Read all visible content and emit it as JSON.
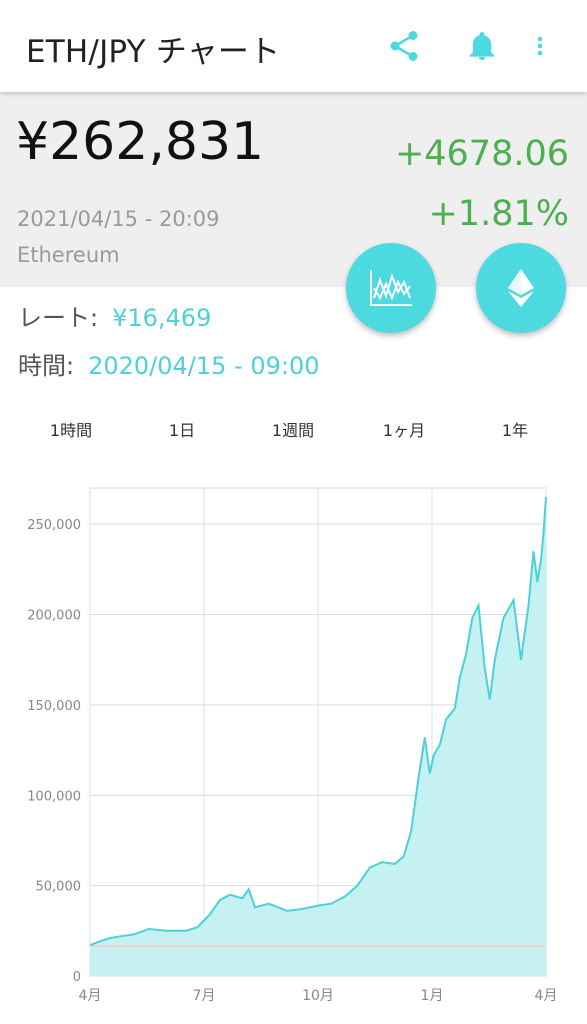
{
  "header": {
    "title": "ETH/JPY チャート"
  },
  "summary": {
    "price": "¥262,831",
    "change": "+4678.06",
    "change_pct": "+1.81%",
    "datetime": "2021/04/15 - 20:09",
    "coin": "Ethereum"
  },
  "info": {
    "rate_label": "レート:",
    "rate_value": "¥16,469",
    "time_label": "時間:",
    "time_value": "2020/04/15 - 09:00"
  },
  "tabs": [
    {
      "label": "1時間",
      "active": false
    },
    {
      "label": "1日",
      "active": false
    },
    {
      "label": "1週間",
      "active": false
    },
    {
      "label": "1ヶ月",
      "active": false
    },
    {
      "label": "1年",
      "active": true
    }
  ],
  "icons": {
    "share": "share-icon",
    "bell": "bell-icon",
    "more": "more-vert-icon",
    "chart_fab": "line-chart-icon",
    "coin_fab": "ethereum-icon"
  },
  "colors": {
    "accent": "#4dd9e0",
    "positive": "#4caf50",
    "line": "#4dd0d8",
    "fill": "#c6f1f2"
  },
  "chart_data": {
    "type": "area",
    "xlabel": "",
    "ylabel": "",
    "ylim": [
      0,
      270000
    ],
    "y_ticks": [
      0,
      50000,
      100000,
      150000,
      200000,
      250000
    ],
    "y_tick_labels": [
      "0",
      "50,000",
      "100,000",
      "150,000",
      "200,000",
      "250,000"
    ],
    "x_tick_labels": [
      "4月",
      "7月",
      "10月",
      "1月",
      "4月"
    ],
    "x_range": [
      "2020-04-15",
      "2021-04-15"
    ],
    "reference_line": 16469,
    "series": [
      {
        "x": [
          "2020-04-15",
          "2020-04-22",
          "2020-05-01",
          "2020-05-10",
          "2020-05-20",
          "2020-06-01",
          "2020-06-15",
          "2020-07-01",
          "2020-07-10",
          "2020-07-20",
          "2020-07-28",
          "2020-08-05",
          "2020-08-15",
          "2020-08-20",
          "2020-08-25",
          "2020-09-05",
          "2020-09-20",
          "2020-10-01",
          "2020-10-15",
          "2020-10-25",
          "2020-11-05",
          "2020-11-15",
          "2020-11-25",
          "2020-12-05",
          "2020-12-15",
          "2020-12-22",
          "2020-12-28",
          "2021-01-03",
          "2021-01-08",
          "2021-01-12",
          "2021-01-15",
          "2021-01-20",
          "2021-01-25",
          "2021-02-01",
          "2021-02-05",
          "2021-02-10",
          "2021-02-15",
          "2021-02-20",
          "2021-02-25",
          "2021-03-01",
          "2021-03-05",
          "2021-03-12",
          "2021-03-20",
          "2021-03-26",
          "2021-04-01",
          "2021-04-05",
          "2021-04-08",
          "2021-04-11",
          "2021-04-13",
          "2021-04-15"
        ],
        "values": [
          17000,
          19000,
          21000,
          22000,
          23000,
          26000,
          25000,
          25000,
          27000,
          34000,
          42000,
          45000,
          43000,
          48000,
          38000,
          40000,
          36000,
          37000,
          39000,
          40000,
          44000,
          50000,
          60000,
          63000,
          62000,
          66000,
          80000,
          110000,
          132000,
          112000,
          122000,
          128000,
          142000,
          148000,
          165000,
          178000,
          198000,
          205000,
          170000,
          153000,
          175000,
          198000,
          208000,
          175000,
          205000,
          235000,
          218000,
          230000,
          245000,
          265000
        ]
      }
    ]
  }
}
